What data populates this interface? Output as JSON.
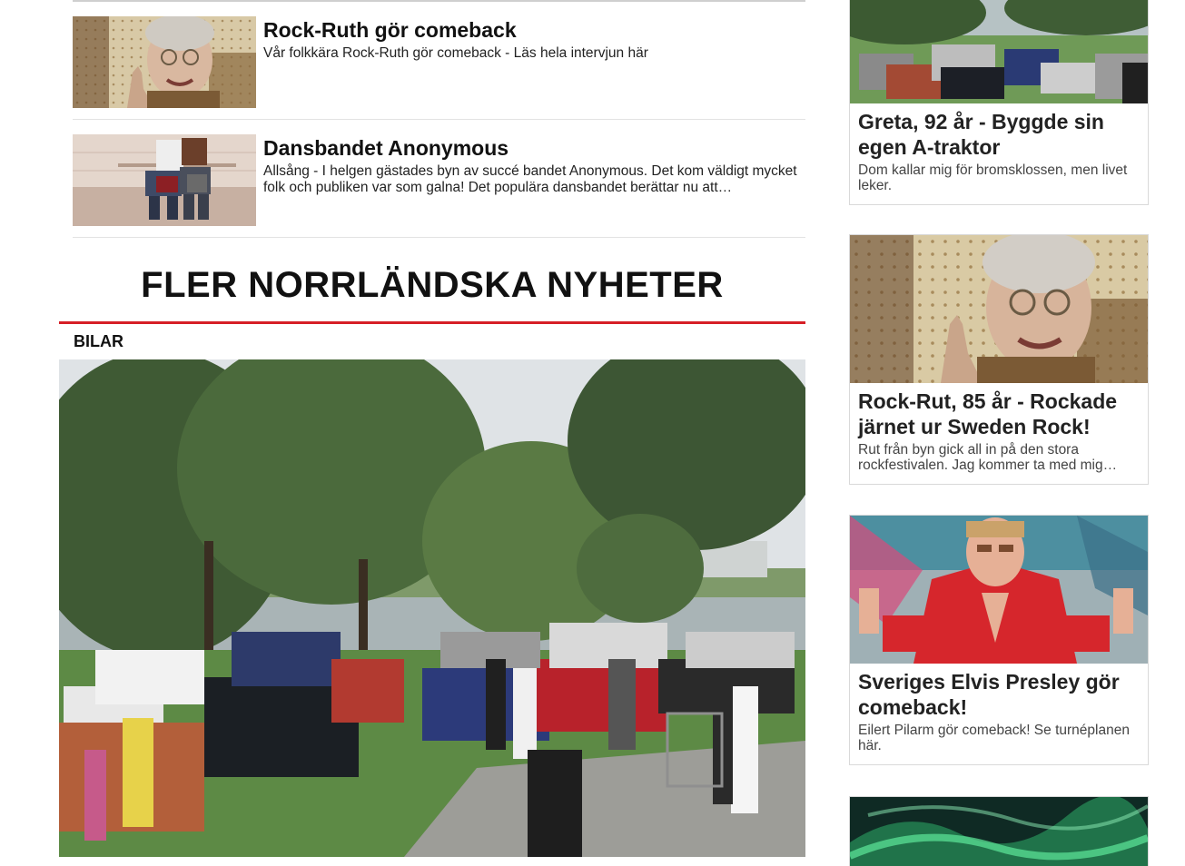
{
  "list_articles": [
    {
      "title": "Rock-Ruth gör comeback",
      "description": "Vår folkkära Rock-Ruth gör comeback - Läs hela intervjun här"
    },
    {
      "title": "Dansbandet Anonymous",
      "description": "Allsång - I helgen gästades byn av succé bandet Anonymous. Det kom väldigt mycket folk och publiken var som galna! Det populära dansbandet berättar nu att…"
    }
  ],
  "section": {
    "heading": "FLER NORRLÄNDSKA NYHETER",
    "category": "BILAR"
  },
  "side_cards": [
    {
      "title": "Greta, 92 år - Byggde sin egen A-traktor",
      "description": "Dom kallar mig för bromsklossen, men livet leker."
    },
    {
      "title": "Rock-Rut, 85 år - Rockade järnet ur Sweden Rock!",
      "description": "Rut från byn gick all in på den stora rockfestivalen. Jag kommer ta med mig…"
    },
    {
      "title": "Sveriges Elvis Presley gör comeback!",
      "description": "Eilert Pilarm gör comeback! Se turnéplanen här."
    }
  ],
  "colors": {
    "accent_red": "#d61f26",
    "text": "#111111",
    "border": "#d9d9d9"
  }
}
